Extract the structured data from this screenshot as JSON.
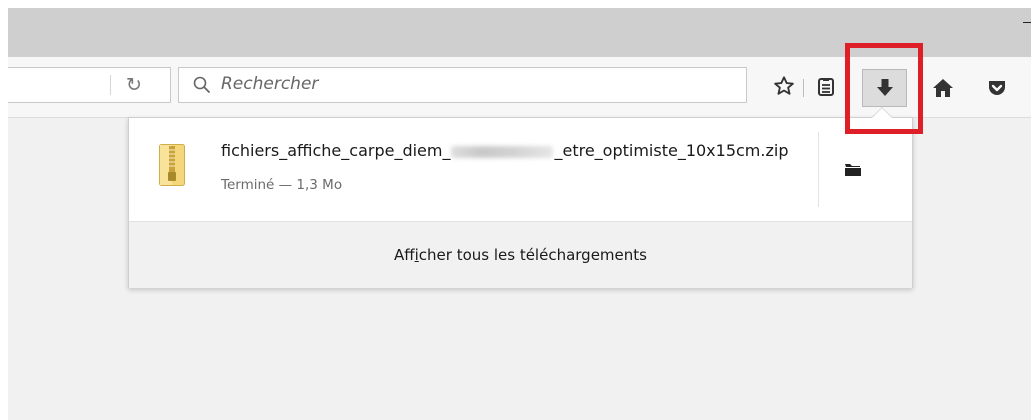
{
  "toolbar": {
    "reload_icon": "reload-icon",
    "search_placeholder": "Rechercher",
    "icons": [
      "star-bookmark-icon",
      "reading-list-icon",
      "download-arrow-icon",
      "home-icon",
      "pocket-icon"
    ]
  },
  "downloads_panel": {
    "item": {
      "filename_start": "fichiers_affiche_carpe_diem_",
      "filename_end": "_etre_optimiste_10x15cm.zip",
      "status": "Terminé — 1,3 Mo",
      "file_icon": "zip-archive-icon",
      "action_icon": "folder-icon"
    },
    "show_all_prefix": "Aff",
    "show_all_mnemonic": "i",
    "show_all_suffix": "cher tous les téléchargements"
  },
  "colors": {
    "highlight": "#df1f28",
    "titlebar": "#cfcfcf",
    "toolbar_icon": "#333333"
  }
}
